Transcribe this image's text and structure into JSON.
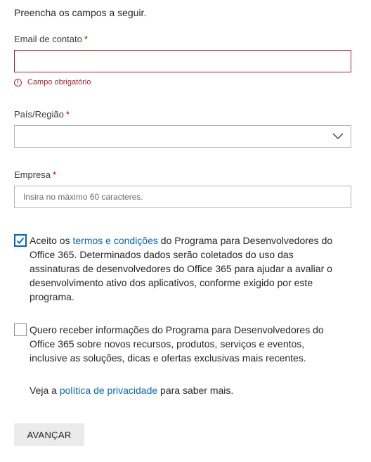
{
  "intro": "Preencha os campos a seguir.",
  "email": {
    "label": "Email de contato",
    "required_mark": "*",
    "value": "",
    "error": "Campo obrigatório"
  },
  "country": {
    "label": "País/Região",
    "required_mark": "*",
    "selected": ""
  },
  "company": {
    "label": "Empresa",
    "required_mark": "*",
    "value": "",
    "placeholder": "Insira no máximo 60 caracteres."
  },
  "terms": {
    "checked": true,
    "text_before": "Aceito os ",
    "link": "termos e condições",
    "text_after": " do Programa para Desenvolvedores do Office 365. Determinados dados serão coletados do uso das assinaturas de desenvolvedores do Office 365 para ajudar a avaliar o desenvolvimento ativo dos aplicativos, conforme exigido por este programa."
  },
  "newsletter": {
    "checked": false,
    "text": "Quero receber informações do Programa para Desenvolvedores do Office 365 sobre novos recursos, produtos, serviços e eventos, inclusive as soluções, dicas e ofertas exclusivas mais recentes."
  },
  "privacy": {
    "text_before": "Veja a ",
    "link": "política de privacidade",
    "text_after": " para saber mais."
  },
  "submit_label": "AVANÇAR",
  "colors": {
    "accent": "#0067b8",
    "error": "#a4262c",
    "button_bg": "#ebebeb"
  }
}
